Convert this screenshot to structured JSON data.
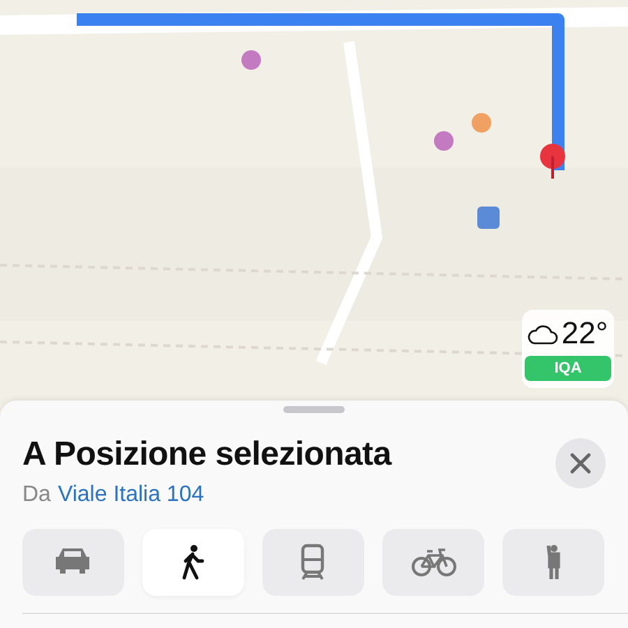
{
  "weather": {
    "temperature": "22°",
    "air_quality": {
      "label": "IQA",
      "color": "#34c46a"
    }
  },
  "sheet": {
    "title": "A Posizione selezionata",
    "origin_prefix": "Da",
    "origin": "Viale Italia 104"
  },
  "modes": [
    {
      "kind": "car",
      "selected": false
    },
    {
      "kind": "walk",
      "selected": true
    },
    {
      "kind": "transit",
      "selected": false
    },
    {
      "kind": "bike",
      "selected": false
    },
    {
      "kind": "ride",
      "selected": false
    }
  ]
}
